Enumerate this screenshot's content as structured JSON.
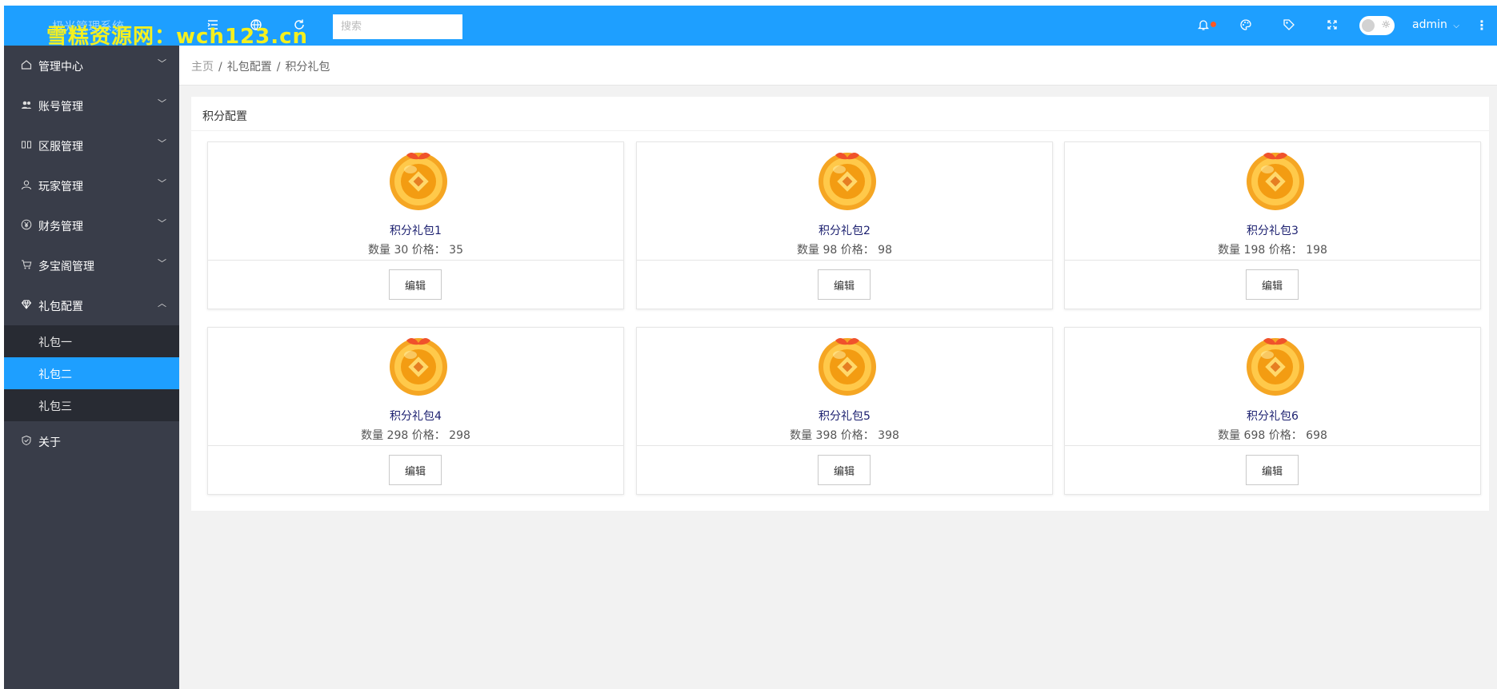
{
  "app": {
    "title": "极光管理系统",
    "watermark": "雪糕资源网：wch123.cn"
  },
  "topbar": {
    "search_placeholder": "搜索",
    "user": "admin",
    "icons": [
      "menu-fold-icon",
      "globe-icon",
      "refresh-icon",
      "bell-icon",
      "palette-icon",
      "tag-icon",
      "fullscreen-icon",
      "theme-toggle",
      "more-vertical-icon"
    ],
    "notification_dot_color": "#ff5722",
    "accent_color": "#1e9fff"
  },
  "sidebar": {
    "items": [
      {
        "label": "管理中心",
        "icon": "home-icon",
        "expanded": false
      },
      {
        "label": "账号管理",
        "icon": "users-icon",
        "expanded": false
      },
      {
        "label": "区服管理",
        "icon": "server-icon",
        "expanded": false
      },
      {
        "label": "玩家管理",
        "icon": "user-icon",
        "expanded": false
      },
      {
        "label": "财务管理",
        "icon": "yen-icon",
        "expanded": false
      },
      {
        "label": "多宝阁管理",
        "icon": "cart-icon",
        "expanded": false
      },
      {
        "label": "礼包配置",
        "icon": "diamond-icon",
        "expanded": true
      },
      {
        "label": "关于",
        "icon": "shield-icon",
        "expanded": false
      }
    ],
    "submenu": [
      {
        "label": "礼包一",
        "active": false
      },
      {
        "label": "礼包二",
        "active": true
      },
      {
        "label": "礼包三",
        "active": false
      }
    ],
    "bg_color": "#393d49",
    "sub_bg_color": "#282b33"
  },
  "breadcrumb": {
    "home": "主页",
    "level1": "礼包配置",
    "level2": "积分礼包",
    "separator": "/"
  },
  "panel": {
    "title": "积分配置"
  },
  "packs": [
    {
      "name": "积分礼包1",
      "info": "数量 30 价格： 35",
      "edit_label": "编辑"
    },
    {
      "name": "积分礼包2",
      "info": "数量 98 价格： 98",
      "edit_label": "编辑"
    },
    {
      "name": "积分礼包3",
      "info": "数量 198 价格： 198",
      "edit_label": "编辑"
    },
    {
      "name": "积分礼包4",
      "info": "数量 298 价格： 298",
      "edit_label": "编辑"
    },
    {
      "name": "积分礼包5",
      "info": "数量 398 价格： 398",
      "edit_label": "编辑"
    },
    {
      "name": "积分礼包6",
      "info": "数量 698 价格： 698",
      "edit_label": "编辑"
    }
  ]
}
